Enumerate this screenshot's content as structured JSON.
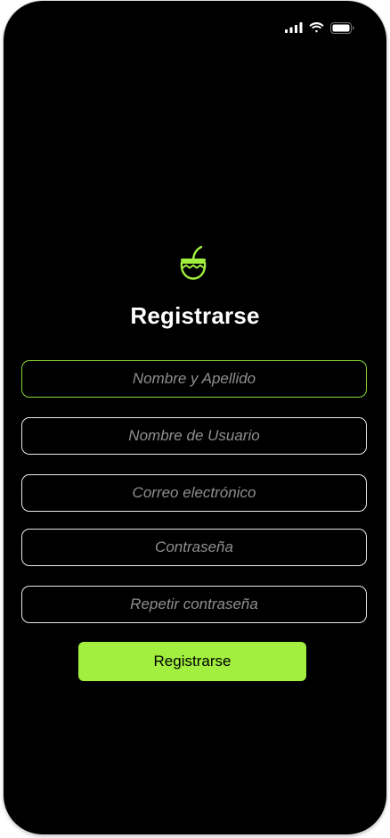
{
  "status_bar": {
    "icons": [
      "cellular-signal-icon",
      "wifi-icon",
      "battery-icon"
    ]
  },
  "logo": {
    "icon": "mate-gourd-icon",
    "color": "#a2ef3f"
  },
  "page": {
    "title": "Registrarse"
  },
  "form": {
    "full_name": {
      "placeholder": "Nombre y Apellido",
      "value": ""
    },
    "username": {
      "placeholder": "Nombre de Usuario",
      "value": ""
    },
    "email": {
      "placeholder": "Correo electrónico",
      "value": ""
    },
    "password": {
      "placeholder": "Contraseña",
      "value": ""
    },
    "repeat_password": {
      "placeholder": "Repetir contraseña",
      "value": ""
    },
    "submit_label": "Registrarse"
  },
  "colors": {
    "background": "#000000",
    "accent": "#a2ef3f",
    "focus_border": "#86d63a",
    "field_border": "#e8e8e8",
    "placeholder": "#8f8f8f"
  }
}
